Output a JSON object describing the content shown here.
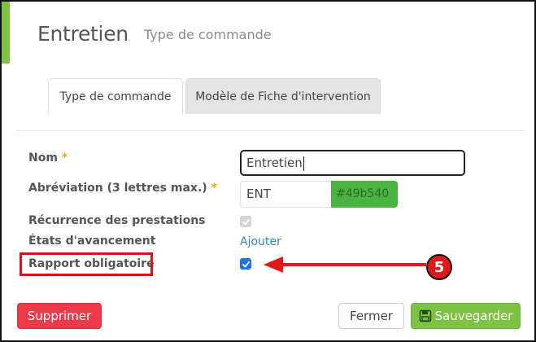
{
  "header": {
    "title": "Entretien",
    "subtitle": "Type de commande"
  },
  "tabs": [
    {
      "label": "Type de commande",
      "active": true
    },
    {
      "label": "Modèle de Fiche d'intervention",
      "active": false
    }
  ],
  "form": {
    "nom": {
      "label": "Nom",
      "required_mark": "*",
      "value": "Entretien"
    },
    "abreviation": {
      "label": "Abréviation (3 lettres max.)",
      "required_mark": "*",
      "value": "ENT",
      "color_value": "#49b540"
    },
    "recurrence": {
      "label": "Récurrence des prestations",
      "checked": true,
      "disabled": true
    },
    "etats": {
      "label": "États d'avancement",
      "link_label": "Ajouter"
    },
    "rapport": {
      "label": "Rapport obligatoire",
      "checked": true
    }
  },
  "annotation": {
    "badge_number": "5",
    "color": "#e01a1a"
  },
  "buttons": {
    "delete_label": "Supprimer",
    "close_label": "Fermer",
    "save_label": "Sauvegarder"
  },
  "colors": {
    "accent": "#7dc243",
    "danger": "#ec3a4a",
    "link": "#2f8ac4",
    "swatch": "#49b540"
  },
  "icons": {
    "save": "floppy-disk-icon",
    "check": "checkmark-icon",
    "arrow": "arrow-left-icon"
  }
}
